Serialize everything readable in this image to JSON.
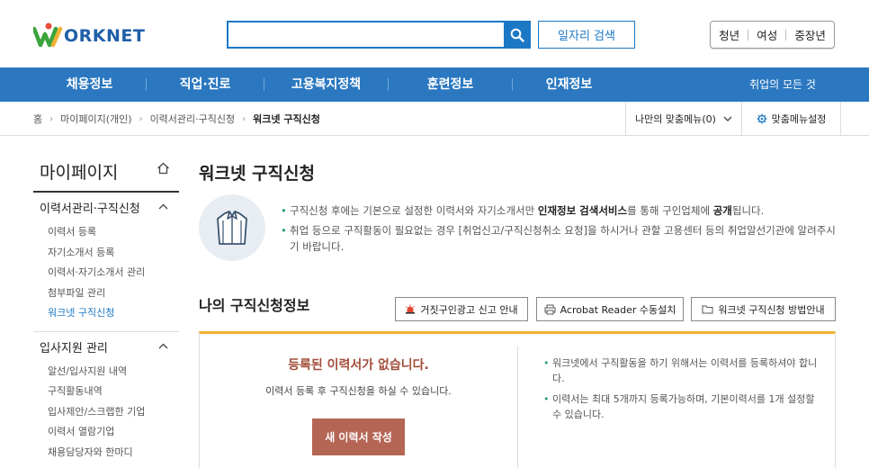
{
  "header": {
    "logo_text": "ORKNET",
    "search": {
      "value": "",
      "placeholder": ""
    },
    "job_search_label": "일자리 검색",
    "audience": [
      "청년",
      "여성",
      "중장년"
    ]
  },
  "gnb": {
    "items": [
      "채용정보",
      "직업·진로",
      "고용복지정책",
      "훈련정보",
      "인재정보"
    ],
    "all_label": "취업의 모든 것"
  },
  "breadcrumb": {
    "items": [
      "홈",
      "마이페이지(개인)",
      "이력서관리·구직신청",
      "워크넷 구직신청"
    ],
    "my_menu_label": "나만의 맞춤메뉴(0)",
    "menu_setting_label": "맞춤메뉴설정"
  },
  "sidebar": {
    "title": "마이페이지",
    "groups": [
      {
        "label": "이력서관리·구직신청",
        "items": [
          "이력서 등록",
          "자기소개서 등록",
          "이력서·자기소개서 관리",
          "첨부파일 관리",
          "워크넷 구직신청"
        ]
      },
      {
        "label": "입사지원 관리",
        "items": [
          "알선/입사지원 내역",
          "구직활동내역",
          "입사제안/스크랩한 기업",
          "이력서 열람기업",
          "채용담당자와 한마디"
        ]
      }
    ]
  },
  "content": {
    "title": "워크넷 구직신청",
    "notice": {
      "n1_a": "구직신청 후에는 기본으로 설정한 이력서와 자기소개서만 ",
      "n1_b": "인재정보 검색서비스",
      "n1_c": "를 통해 구인업체에 ",
      "n1_d": "공개",
      "n1_e": "됩니다.",
      "n2": "취업 등으로 구직활동이 필요없는 경우 [취업신고/구직신청취소 요청]을 하시거나 관할 고용센터 등의 취업알선기관에 알려주시기 바랍니다."
    },
    "section_title": "나의 구직신청정보",
    "buttons": {
      "report_label": "거짓구인광고 신고 안내",
      "acrobat_label": "Acrobat Reader 수동설치",
      "guide_label": "워크넷 구직신청 방법안내"
    },
    "status": {
      "title": "등록된 이력서가 없습니다.",
      "desc": "이력서 등록 후 구직신청을 하실 수 있습니다.",
      "new_resume_label": "새 이력서 작성",
      "note1": "워크넷에서 구직활동을 하기 위해서는 이력서를 등록하셔야 합니다.",
      "note2": "이력서는 최대 5개까지 등록가능하며, 기본이력서를 1개 설정할 수 있습니다."
    }
  },
  "colors": {
    "brand_blue": "#1b78c4",
    "nav_blue": "#2b78c0",
    "accent_orange": "#f2b233",
    "button_brick": "#b56554"
  }
}
